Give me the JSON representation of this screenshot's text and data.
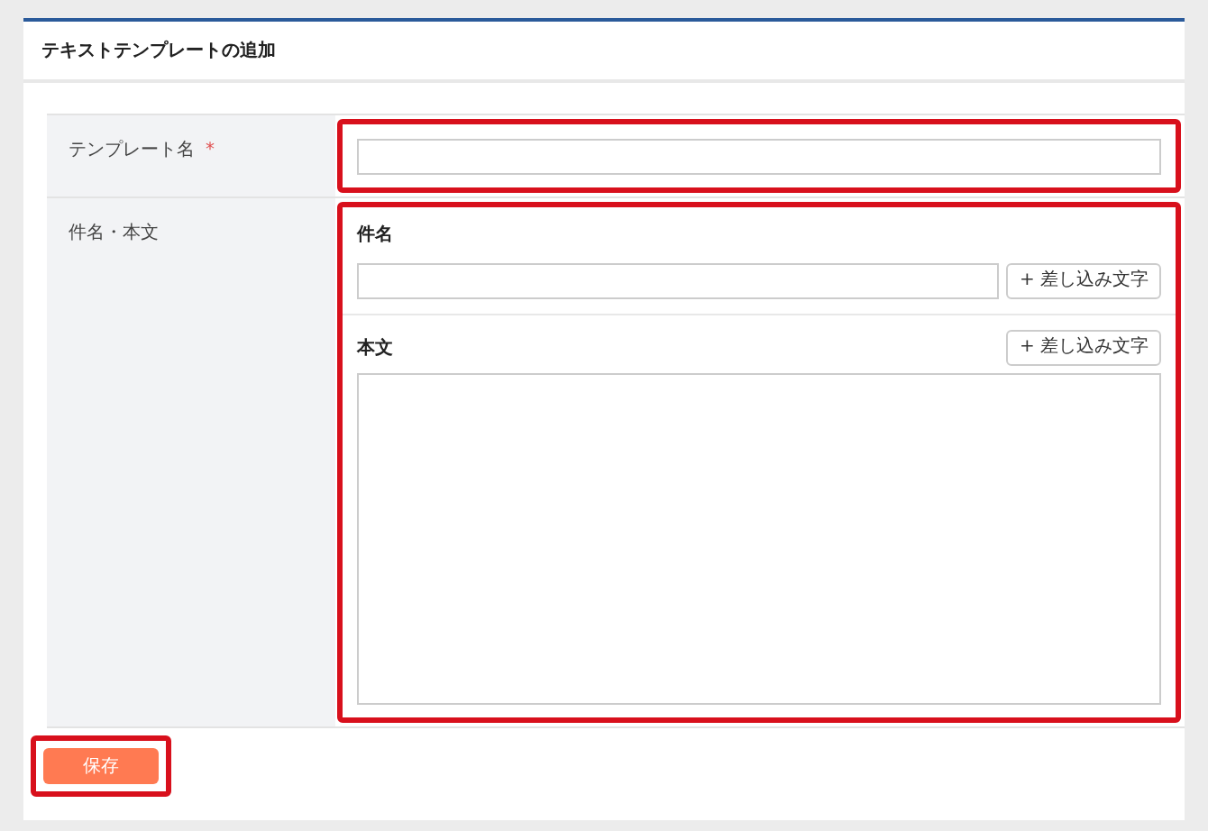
{
  "title": "テキストテンプレートの追加",
  "template_name": {
    "label": "テンプレート名",
    "required_mark": "*",
    "highlighted": true
  },
  "subject_body": {
    "label": "件名・本文",
    "highlighted": true,
    "subject": {
      "label": "件名",
      "insert_button": "+ 差し込み文字"
    },
    "body": {
      "label": "本文",
      "insert_button": "+ 差し込み文字"
    }
  },
  "save_button": {
    "label": "保存",
    "highlighted": true
  }
}
